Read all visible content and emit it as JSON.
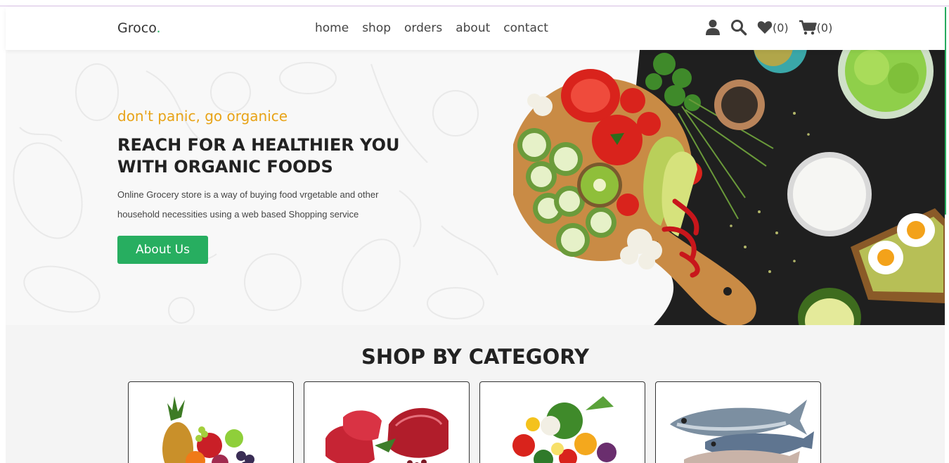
{
  "header": {
    "logo": "Groco",
    "logo_dot": ".",
    "nav": [
      "home",
      "shop",
      "orders",
      "about",
      "contact"
    ],
    "icons": [
      "user-icon",
      "search-icon",
      "heart-icon",
      "cart-icon"
    ],
    "wishlist_count": "(0)",
    "cart_count": "(0)"
  },
  "hero": {
    "tagline": "don't panic, go organice",
    "title_line1": "REACH FOR A HEALTHIER YOU",
    "title_line2": "WITH ORGANIC FOODS",
    "description": "Online Grocery store is a way of buying food vrgetable and other household necessities using a web based Shopping service",
    "button_label": "About Us"
  },
  "category": {
    "title": "SHOP BY CATEGORY",
    "cards": [
      "fruits",
      "meat",
      "vegetables",
      "fish"
    ]
  },
  "colors": {
    "accent_green": "#27ae60",
    "tagline_orange": "#e8a317",
    "text_dark": "#222222"
  }
}
